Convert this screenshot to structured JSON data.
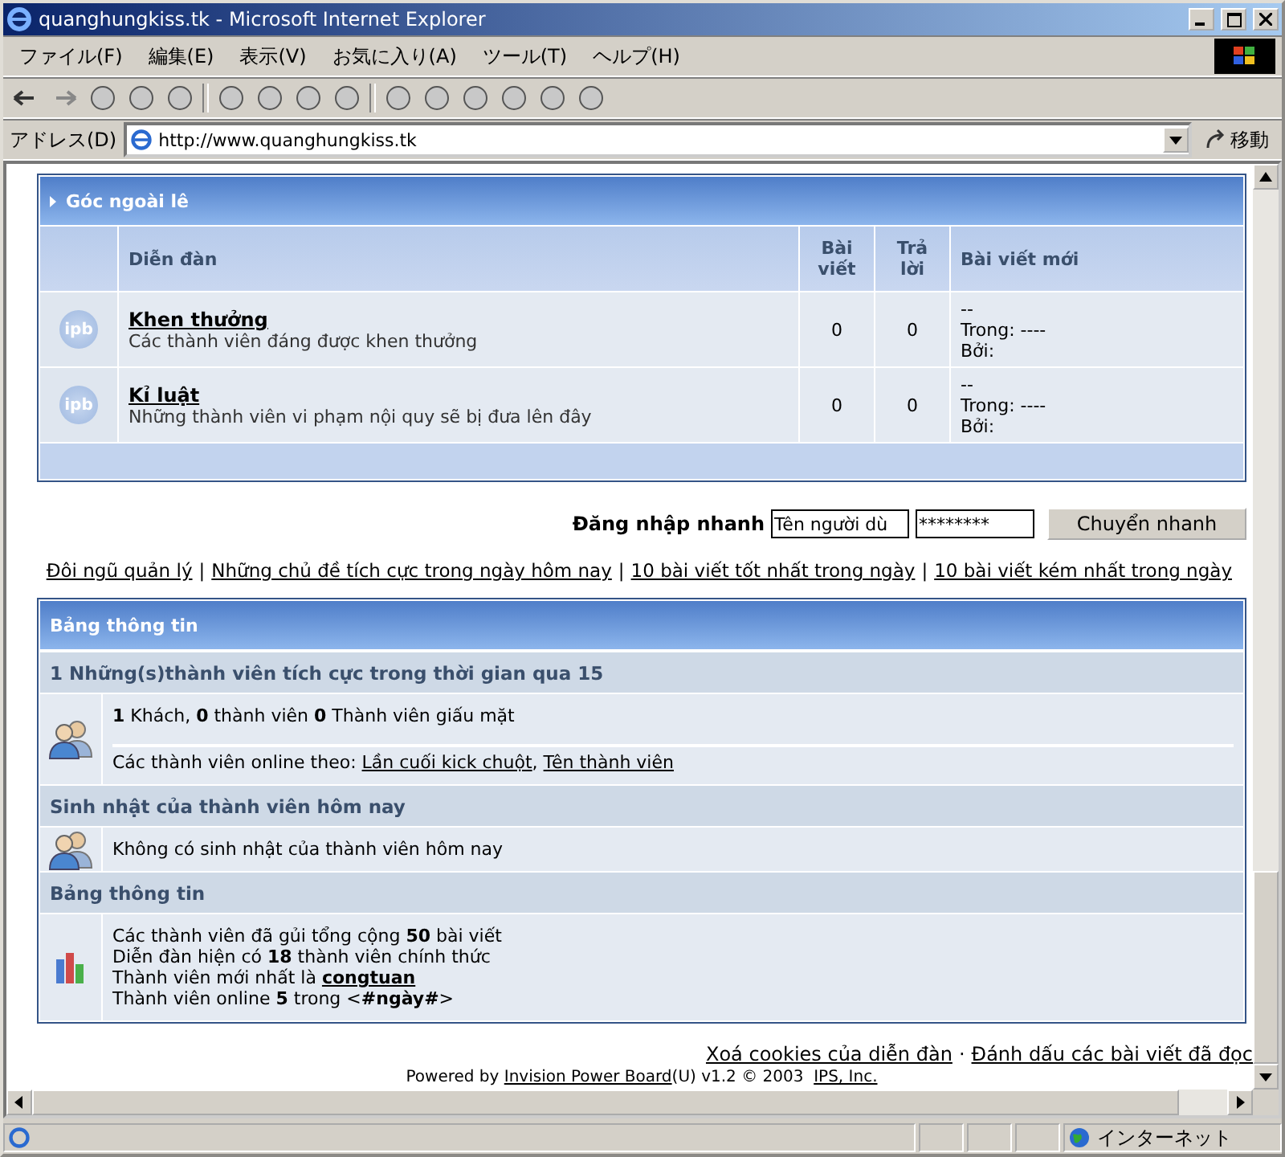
{
  "window": {
    "title": "quanghungkiss.tk - Microsoft Internet Explorer"
  },
  "menu": [
    "ファイル(F)",
    "編集(E)",
    "表示(V)",
    "お気に入り(A)",
    "ツール(T)",
    "ヘルプ(H)"
  ],
  "address": {
    "label": "アドレス(D)",
    "url": "http://www.quanghungkiss.tk",
    "go": "移動"
  },
  "forum_category": {
    "title": "Góc ngoài lê",
    "columns": [
      "Diễn đàn",
      "Bài viết",
      "Trả lời",
      "Bài viết mới"
    ],
    "rows": [
      {
        "icon_label": "ipb",
        "name": "Khen thưởng",
        "description": "Các thành viên đáng được khen thưởng",
        "posts": "0",
        "replies": "0",
        "last_post": [
          "--",
          "Trong: ----",
          "Bởi:"
        ]
      },
      {
        "icon_label": "ipb",
        "name": "Kỉ luật",
        "description": "Những thành viên vi phạm nội quy sẽ bị đưa lên đây",
        "posts": "0",
        "replies": "0",
        "last_post": [
          "--",
          "Trong: ----",
          "Bởi:"
        ]
      }
    ]
  },
  "quick_login": {
    "label": "Đăng nhập nhanh",
    "username": "Tên người dù",
    "password": "********",
    "button": "Chuyển nhanh"
  },
  "links": {
    "separator": "|",
    "items": [
      "Đôi ngũ quản lý",
      "Những chủ đề tích cực trong ngày hôm nay",
      "10 bài viết tốt nhất trong ngày",
      "10 bài viết kém nhất trong ngày"
    ]
  },
  "info_board": {
    "title": "Bảng thông tin",
    "sections": [
      {
        "kind": "header",
        "text": "1 Những(s)thành viên tích cực trong thời gian qua 15"
      },
      {
        "kind": "users",
        "blocks": [
          [
            [
              {
                "kind": "text",
                "text": "**1** Khách, **0** thành viên **0** Thành viên giấu mặt"
              }
            ]
          ],
          [
            [
              {
                "kind": "text",
                "text": "Các thành viên online theo: "
              },
              {
                "kind": "link_list",
                "separator": ", ",
                "items": [
                  "Lần cuối kick chuột",
                  "Tên thành viên"
                ]
              }
            ]
          ]
        ]
      },
      {
        "kind": "header",
        "text": "Sinh nhật của thành viên hôm nay"
      },
      {
        "kind": "users",
        "blocks": [
          [
            [
              {
                "kind": "text",
                "text": "Không có sinh nhật của thành viên hôm nay"
              }
            ]
          ]
        ]
      },
      {
        "kind": "header",
        "text": "Bảng thông tin"
      },
      {
        "kind": "stats",
        "blocks": [
          [
            [
              {
                "kind": "text",
                "text": "Các thành viên đã gủi tổng cộng **50** bài viết"
              }
            ],
            [
              {
                "kind": "text",
                "text": "Diễn đàn hiện có **18** thành viên chính thức"
              }
            ],
            [
              {
                "kind": "text",
                "text": "Thành viên mới nhất là "
              },
              {
                "kind": "link",
                "text": "**congtuan**"
              }
            ],
            [
              {
                "kind": "text",
                "text": "Thành viên online **5** trong <**#ngày#**>"
              }
            ]
          ]
        ]
      }
    ]
  },
  "footer": {
    "separator": "·",
    "links": [
      "Xoá cookies của diễn đàn ",
      "Đánh dấu các bài viết đã đọc"
    ],
    "powered": [
      {
        "kind": "text",
        "text": "Powered by "
      },
      {
        "kind": "link",
        "text": "Invision Power Board"
      },
      {
        "kind": "text",
        "text": "(U) v1.2 © 2003  "
      },
      {
        "kind": "link",
        "text": "IPS, Inc."
      }
    ]
  },
  "status_bar": {
    "zone": "インターネット"
  }
}
